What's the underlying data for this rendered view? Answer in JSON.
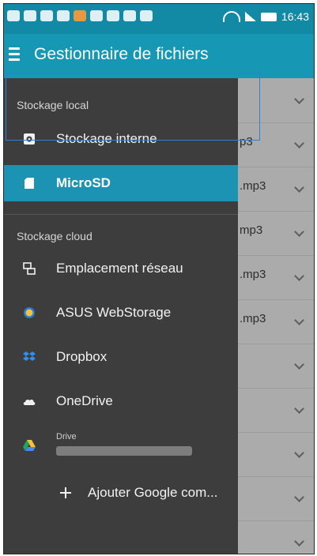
{
  "status": {
    "time": "16:43"
  },
  "appbar": {
    "title": "Gestionnaire de fichiers"
  },
  "drawer": {
    "local_header": "Stockage local",
    "local_items": [
      "Stockage interne",
      "MicroSD"
    ],
    "cloud_header": "Stockage cloud",
    "cloud_items": [
      "Emplacement réseau",
      "ASUS WebStorage",
      "Dropbox",
      "OneDrive"
    ],
    "drive": {
      "label": "Drive"
    },
    "add_google": "Ajouter Google com..."
  },
  "background_list": {
    "filenames": [
      "p3",
      ".mp3",
      "mp3",
      ".mp3",
      ".mp3"
    ]
  },
  "colors": {
    "accent": "#1697b4",
    "drawer_bg": "#3d3d3d",
    "selected": "#1c93b2"
  },
  "icons": [
    "hamburger-icon",
    "sd-card-icon",
    "network-icon",
    "webstorage-icon",
    "dropbox-icon",
    "onedrive-icon",
    "google-drive-icon",
    "plus-icon",
    "chevron-down-icon"
  ]
}
